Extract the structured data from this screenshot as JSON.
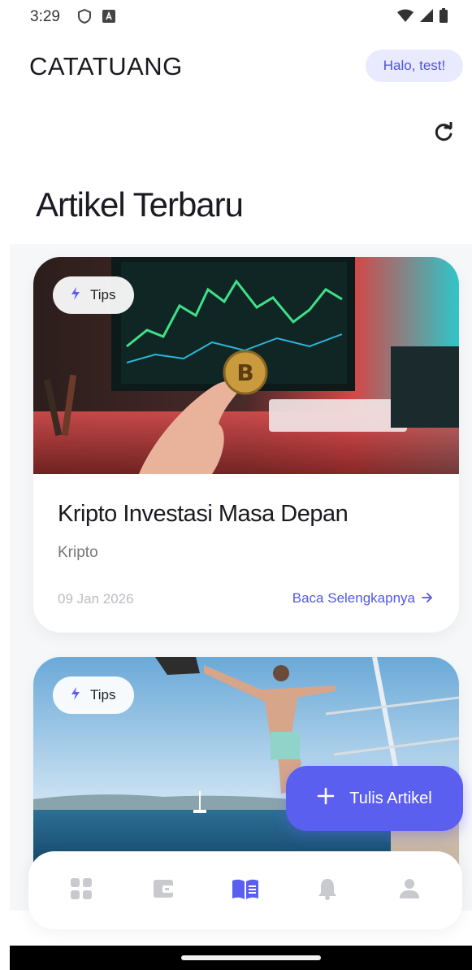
{
  "status_bar": {
    "time": "3:29"
  },
  "header": {
    "app_title": "CATATUANG",
    "greeting": "Halo, test!"
  },
  "section_title": "Artikel Terbaru",
  "articles": [
    {
      "tag": "Tips",
      "title": "Kripto Investasi Masa Depan",
      "category": "Kripto",
      "date": "09 Jan 2026",
      "read_more": "Baca Selengkapnya"
    },
    {
      "tag": "Tips"
    }
  ],
  "fab": {
    "label": "Tulis Artikel"
  },
  "nav": {
    "items": [
      "dashboard-icon",
      "wallet-icon",
      "article-icon",
      "bell-icon",
      "profile-icon"
    ],
    "active": "article-icon"
  },
  "colors": {
    "accent": "#5b5ff0",
    "accent_light": "#e9eafd",
    "inactive_icon": "#c9cace"
  }
}
